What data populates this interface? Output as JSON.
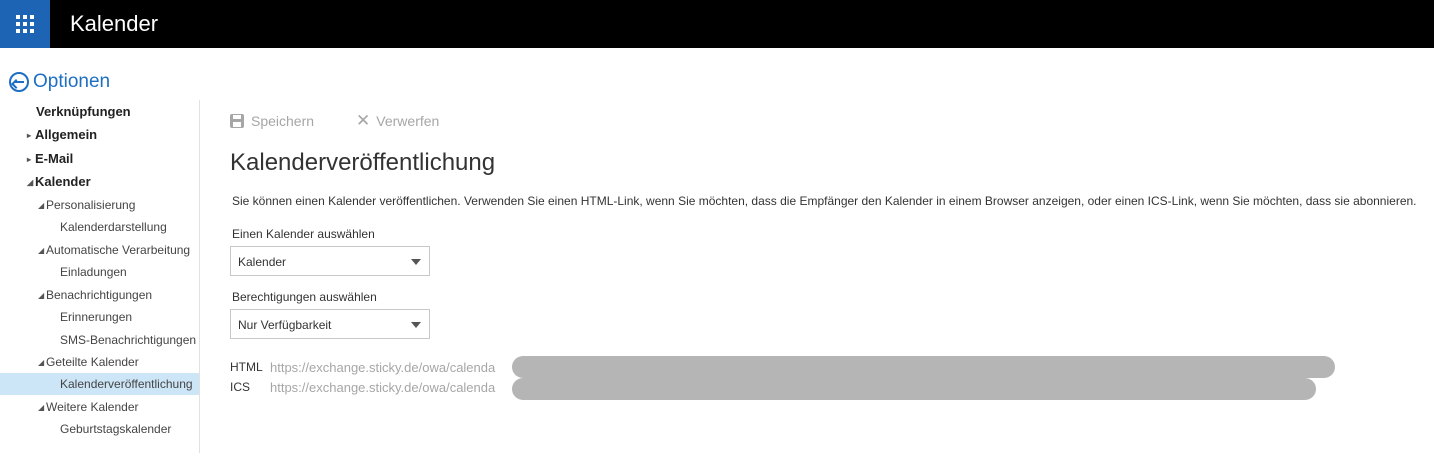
{
  "header": {
    "app_title": "Kalender",
    "waffle_icon": "app-launcher-icon"
  },
  "options": {
    "label": "Optionen",
    "icon": "back-arrow-circle-icon"
  },
  "sidebar": {
    "items": [
      {
        "label": "Verknüpfungen"
      },
      {
        "label": "Allgemein",
        "arrow": "▸"
      },
      {
        "label": "E-Mail",
        "arrow": "▸"
      },
      {
        "label": "Kalender",
        "arrow": "◢"
      },
      {
        "label": "Personalisierung",
        "arrow": "◢"
      },
      {
        "label": "Kalenderdarstellung"
      },
      {
        "label": "Automatische Verarbeitung",
        "arrow": "◢"
      },
      {
        "label": "Einladungen"
      },
      {
        "label": "Benachrichtigungen",
        "arrow": "◢"
      },
      {
        "label": "Erinnerungen"
      },
      {
        "label": "SMS-Benachrichtigungen"
      },
      {
        "label": "Geteilte Kalender",
        "arrow": "◢"
      },
      {
        "label": "Kalenderveröffentlichung"
      },
      {
        "label": "Weitere Kalender",
        "arrow": "◢"
      },
      {
        "label": "Geburtstagskalender"
      }
    ]
  },
  "toolbar": {
    "save_label": "Speichern",
    "discard_label": "Verwerfen",
    "discard_glyph": "✕"
  },
  "main": {
    "title": "Kalenderveröffentlichung",
    "description": "Sie können einen Kalender veröffentlichen. Verwenden Sie einen HTML-Link, wenn Sie möchten, dass die Empfänger den Kalender in einem Browser anzeigen, oder einen ICS-Link, wenn Sie möchten, dass sie abonnieren.",
    "calendar_select": {
      "label": "Einen Kalender auswählen",
      "value": "Kalender"
    },
    "permission_select": {
      "label": "Berechtigungen auswählen",
      "value": "Nur Verfügbarkeit"
    },
    "links": [
      {
        "label": "HTML",
        "url": "https://exchange.sticky.de/owa/calenda"
      },
      {
        "label": "ICS",
        "url": "https://exchange.sticky.de/owa/calenda"
      }
    ]
  },
  "colors": {
    "accent": "#1e6fc2",
    "topbar": "#000000",
    "waffle": "#1e64b4",
    "selected": "#cde6f7"
  }
}
